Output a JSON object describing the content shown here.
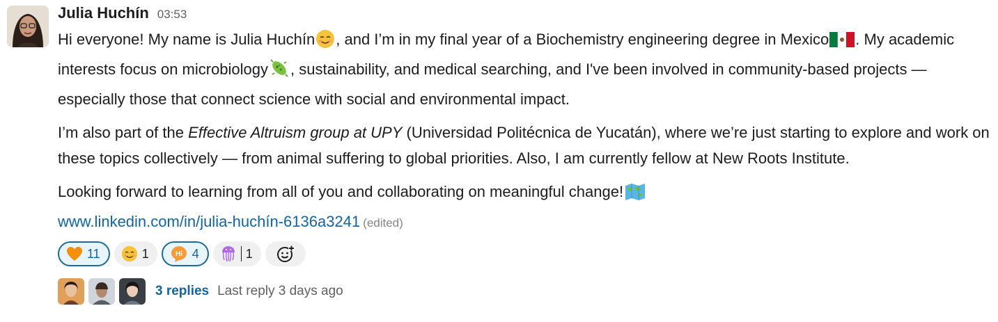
{
  "message": {
    "author": "Julia Huchín",
    "time": "03:53",
    "para1": {
      "a": "Hi everyone! My name is Julia Huchín",
      "b": ", and I’m in my final year of a Biochemistry engineering degree in Mexico",
      "c": ". My academic interests focus on microbiology",
      "d": ", sustainability, and medical searching, and I've been involved in community-based projects — especially those that connect science with social and environmental impact."
    },
    "para2": {
      "a": "I’m also part of the ",
      "em": "Effective Altruism group at UPY",
      "b": " (Universidad Politécnica de Yucatán), where we’re just starting to explore and work on these topics collectively — from animal suffering to global priorities. Also, I am currently fellow at New Roots Institute."
    },
    "para3": {
      "a": "Looking forward to learning from all of you and collaborating on meaningful change!"
    },
    "link": "www.linkedin.com/in/julia-huchín-6136a3241",
    "edited": "(edited)",
    "emojis": [
      "smiling-face-icon",
      "mexico-flag-icon",
      "microbe-icon",
      "world-map-icon"
    ]
  },
  "reactions": [
    {
      "icon": "orange-heart-icon",
      "count": "11",
      "active": true
    },
    {
      "icon": "blush-icon",
      "count": "1",
      "active": false
    },
    {
      "icon": "hi-bubble-icon",
      "count": "4",
      "active": true
    },
    {
      "icon": "jellyfish-icon",
      "count": "1",
      "active": false
    },
    {
      "icon": "add-reaction-icon"
    }
  ],
  "thread": {
    "replies": "3 replies",
    "last_reply": "Last reply 3 days ago"
  },
  "colors": {
    "link": "#1264a3",
    "active_reaction_border": "#1d6a98",
    "active_reaction_bg": "#e8f5fa",
    "reaction_bg": "#f0f0f0"
  }
}
